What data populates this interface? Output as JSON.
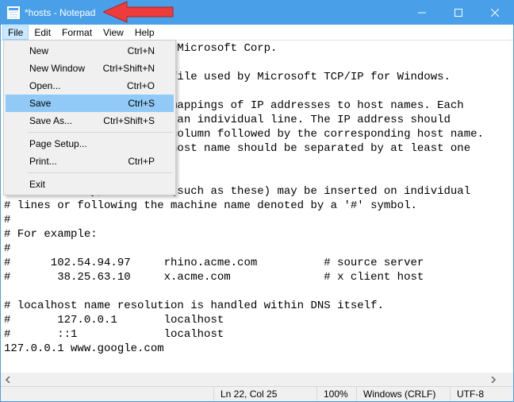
{
  "titlebar": {
    "title": "*hosts - Notepad"
  },
  "menubar": {
    "items": [
      "File",
      "Edit",
      "Format",
      "View",
      "Help"
    ],
    "open_index": 0
  },
  "file_menu": {
    "items": [
      {
        "label": "New",
        "shortcut": "Ctrl+N"
      },
      {
        "label": "New Window",
        "shortcut": "Ctrl+Shift+N"
      },
      {
        "label": "Open...",
        "shortcut": "Ctrl+O"
      },
      {
        "label": "Save",
        "shortcut": "Ctrl+S",
        "highlight": true
      },
      {
        "label": "Save As...",
        "shortcut": "Ctrl+Shift+S"
      },
      {
        "label": "Page Setup...",
        "shortcut": ""
      },
      {
        "label": "Print...",
        "shortcut": "Ctrl+P"
      },
      {
        "label": "Exit",
        "shortcut": ""
      }
    ],
    "separators_after": [
      4,
      6
    ]
  },
  "editor": {
    "text": "# Copyright (c) 1993-2009 Microsoft Corp.\n#\n# This is a sample HOSTS file used by Microsoft TCP/IP for Windows.\n#\n# This file contains the mappings of IP addresses to host names. Each\n# entry should be kept on an individual line. The IP address should\n# be placed in the first column followed by the corresponding host name.\n# The IP address and the host name should be separated by at least one\n# space.\n#\n# Additionally, comments (such as these) may be inserted on individual\n# lines or following the machine name denoted by a '#' symbol.\n#\n# For example:\n#\n#      102.54.94.97     rhino.acme.com          # source server\n#       38.25.63.10     x.acme.com              # x client host\n\n# localhost name resolution is handled within DNS itself.\n#\t127.0.0.1       localhost\n#\t::1             localhost\n127.0.0.1 www.google.com"
  },
  "statusbar": {
    "position": "Ln 22, Col 25",
    "zoom": "100%",
    "line_ending": "Windows (CRLF)",
    "encoding": "UTF-8"
  }
}
